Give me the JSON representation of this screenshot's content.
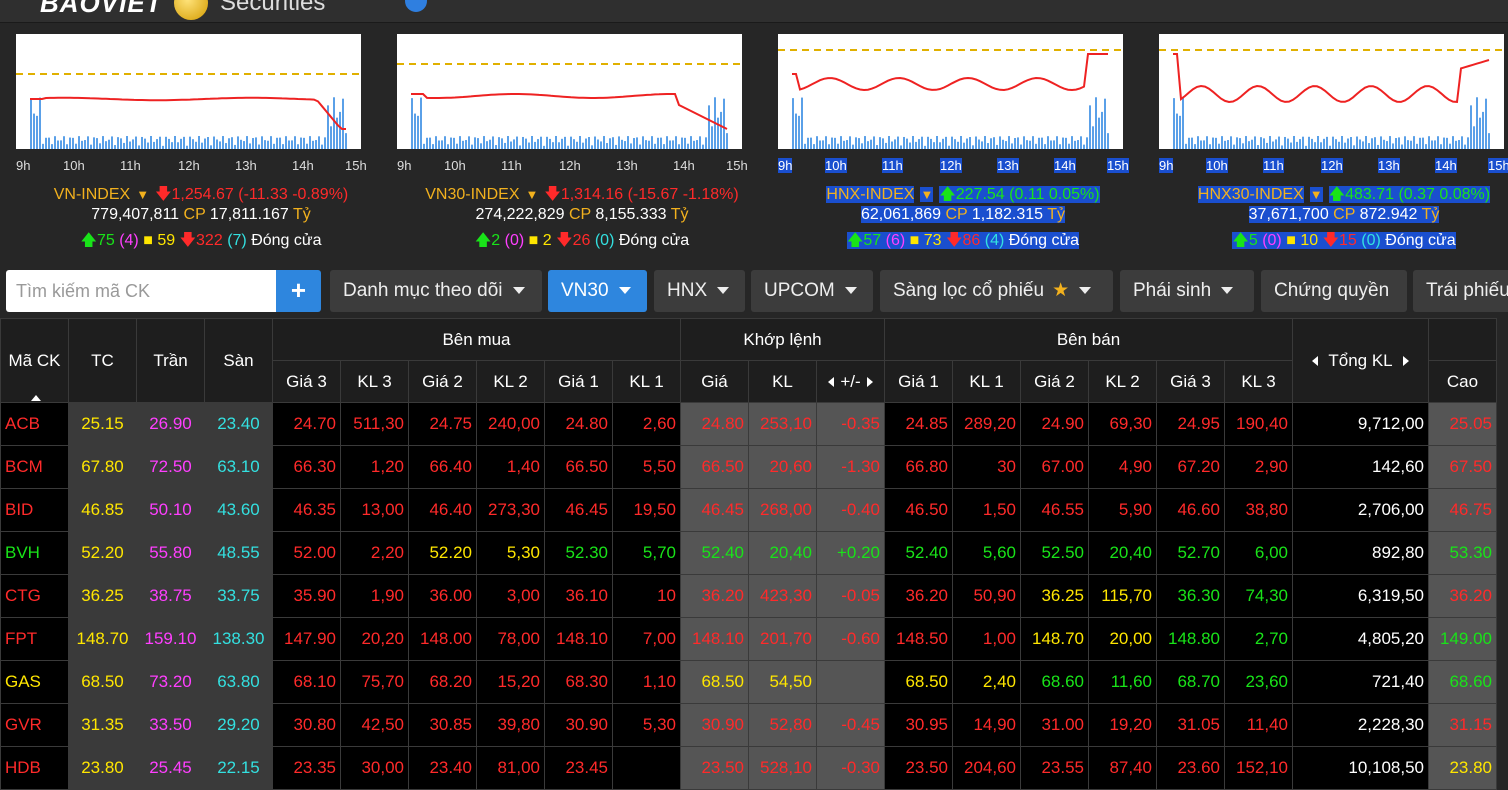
{
  "header": {
    "logo_text": "BAOVIET",
    "logo_sub": "Securities"
  },
  "indices": [
    {
      "name": "VN-INDEX",
      "value": "1,254.67",
      "change": "(-11.33 -0.89%)",
      "direction": "down",
      "volume": "779,407,811",
      "value_traded": "17,811.167",
      "cp_label": "CP",
      "unit": "Tỷ",
      "up": "75",
      "up_ceil": "(4)",
      "ref": "59",
      "down": "322",
      "down_floor": "(7)",
      "status": "Đóng cửa",
      "highlight": false,
      "times": [
        "9h",
        "10h",
        "11h",
        "12h",
        "13h",
        "14h",
        "15h"
      ]
    },
    {
      "name": "VN30-INDEX",
      "value": "1,314.16",
      "change": "(-15.67 -1.18%)",
      "direction": "down",
      "volume": "274,222,829",
      "value_traded": "8,155.333",
      "cp_label": "CP",
      "unit": "Tỷ",
      "up": "2",
      "up_ceil": "(0)",
      "ref": "2",
      "down": "26",
      "down_floor": "(0)",
      "status": "Đóng cửa",
      "highlight": false,
      "times": [
        "9h",
        "10h",
        "11h",
        "12h",
        "13h",
        "14h",
        "15h"
      ]
    },
    {
      "name": "HNX-INDEX",
      "value": "227.54",
      "change": "(0.11 0.05%)",
      "direction": "up",
      "volume": "62,061,869",
      "value_traded": "1,182.315",
      "cp_label": "CP",
      "unit": "Tỷ",
      "up": "57",
      "up_ceil": "(6)",
      "ref": "73",
      "down": "86",
      "down_floor": "(4)",
      "status": "Đóng cửa",
      "highlight": true,
      "times": [
        "9h",
        "10h",
        "11h",
        "12h",
        "13h",
        "14h",
        "15h"
      ]
    },
    {
      "name": "HNX30-INDEX",
      "value": "483.71",
      "change": "(0.37 0.08%)",
      "direction": "up",
      "volume": "37,671,700",
      "value_traded": "872.942",
      "cp_label": "CP",
      "unit": "Tỷ",
      "up": "5",
      "up_ceil": "(0)",
      "ref": "10",
      "down": "15",
      "down_floor": "(0)",
      "status": "Đóng cửa",
      "highlight": true,
      "times": [
        "9h",
        "10h",
        "11h",
        "12h",
        "13h",
        "14h",
        "15h"
      ]
    }
  ],
  "toolbar": {
    "search_placeholder": "Tìm kiếm mã CK",
    "add_label": "+",
    "tabs": [
      "Danh mục theo dõi",
      "VN30",
      "HNX",
      "UPCOM",
      "Sàng lọc cổ phiếu",
      "Phái sinh",
      "Chứng quyền",
      "Trái phiếu"
    ]
  },
  "table": {
    "groups": {
      "sym": "Mã CK",
      "ref": "TC",
      "ceil": "Trần",
      "floor": "Sàn",
      "buy": "Bên mua",
      "match": "Khớp lệnh",
      "sell": "Bên bán",
      "total": "Tổng KL",
      "high": "Cao"
    },
    "buy_cols": [
      "Giá 3",
      "KL 3",
      "Giá 2",
      "KL 2",
      "Giá 1",
      "KL 1"
    ],
    "match_cols": [
      "Giá",
      "KL",
      "+/-"
    ],
    "sell_cols": [
      "Giá 1",
      "KL 1",
      "Giá 2",
      "KL 2",
      "Giá 3",
      "KL 3"
    ],
    "rows": [
      {
        "sym": "ACB",
        "tc": "25.15",
        "tran": "26.90",
        "san": "23.40",
        "b3": "24.70",
        "bk3": "511,30",
        "b2": "24.75",
        "bk2": "240,00",
        "b1": "24.80",
        "bk1": "2,60",
        "mp": "24.80",
        "mk": "253,10",
        "ch": "-0.35",
        "s1": "24.85",
        "sk1": "289,20",
        "s2": "24.90",
        "sk2": "69,30",
        "s3": "24.95",
        "sk3": "190,40",
        "tot": "9,712,00",
        "cao": "25.05"
      },
      {
        "sym": "BCM",
        "tc": "67.80",
        "tran": "72.50",
        "san": "63.10",
        "b3": "66.30",
        "bk3": "1,20",
        "b2": "66.40",
        "bk2": "1,40",
        "b1": "66.50",
        "bk1": "5,50",
        "mp": "66.50",
        "mk": "20,60",
        "ch": "-1.30",
        "s1": "66.80",
        "sk1": "30",
        "s2": "67.00",
        "sk2": "4,90",
        "s3": "67.20",
        "sk3": "2,90",
        "tot": "142,60",
        "cao": "67.50"
      },
      {
        "sym": "BID",
        "tc": "46.85",
        "tran": "50.10",
        "san": "43.60",
        "b3": "46.35",
        "bk3": "13,00",
        "b2": "46.40",
        "bk2": "273,30",
        "b1": "46.45",
        "bk1": "19,50",
        "mp": "46.45",
        "mk": "268,00",
        "ch": "-0.40",
        "s1": "46.50",
        "sk1": "1,50",
        "s2": "46.55",
        "sk2": "5,90",
        "s3": "46.60",
        "sk3": "38,80",
        "tot": "2,706,00",
        "cao": "46.75"
      },
      {
        "sym": "BVH",
        "tc": "52.20",
        "tran": "55.80",
        "san": "48.55",
        "b3": "52.00",
        "bk3": "2,20",
        "b2": "52.20",
        "bk2": "5,30",
        "b1": "52.30",
        "bk1": "5,70",
        "mp": "52.40",
        "mk": "20,40",
        "ch": "+0.20",
        "s1": "52.40",
        "sk1": "5,60",
        "s2": "52.50",
        "sk2": "20,40",
        "s3": "52.70",
        "sk3": "6,00",
        "tot": "892,80",
        "cao": "53.30"
      },
      {
        "sym": "CTG",
        "tc": "36.25",
        "tran": "38.75",
        "san": "33.75",
        "b3": "35.90",
        "bk3": "1,90",
        "b2": "36.00",
        "bk2": "3,00",
        "b1": "36.10",
        "bk1": "10",
        "mp": "36.20",
        "mk": "423,30",
        "ch": "-0.05",
        "s1": "36.20",
        "sk1": "50,90",
        "s2": "36.25",
        "sk2": "115,70",
        "s3": "36.30",
        "sk3": "74,30",
        "tot": "6,319,50",
        "cao": "36.20"
      },
      {
        "sym": "FPT",
        "tc": "148.70",
        "tran": "159.10",
        "san": "138.30",
        "b3": "147.90",
        "bk3": "20,20",
        "b2": "148.00",
        "bk2": "78,00",
        "b1": "148.10",
        "bk1": "7,00",
        "mp": "148.10",
        "mk": "201,70",
        "ch": "-0.60",
        "s1": "148.50",
        "sk1": "1,00",
        "s2": "148.70",
        "sk2": "20,00",
        "s3": "148.80",
        "sk3": "2,70",
        "tot": "4,805,20",
        "cao": "149.00"
      },
      {
        "sym": "GAS",
        "tc": "68.50",
        "tran": "73.20",
        "san": "63.80",
        "b3": "68.10",
        "bk3": "75,70",
        "b2": "68.20",
        "bk2": "15,20",
        "b1": "68.30",
        "bk1": "1,10",
        "mp": "68.50",
        "mk": "54,50",
        "ch": "",
        "s1": "68.50",
        "sk1": "2,40",
        "s2": "68.60",
        "sk2": "11,60",
        "s3": "68.70",
        "sk3": "23,60",
        "tot": "721,40",
        "cao": "68.60"
      },
      {
        "sym": "GVR",
        "tc": "31.35",
        "tran": "33.50",
        "san": "29.20",
        "b3": "30.80",
        "bk3": "42,50",
        "b2": "30.85",
        "bk2": "39,80",
        "b1": "30.90",
        "bk1": "5,30",
        "mp": "30.90",
        "mk": "52,80",
        "ch": "-0.45",
        "s1": "30.95",
        "sk1": "14,90",
        "s2": "31.00",
        "sk2": "19,20",
        "s3": "31.05",
        "sk3": "11,40",
        "tot": "2,228,30",
        "cao": "31.15"
      },
      {
        "sym": "HDB",
        "tc": "23.80",
        "tran": "25.45",
        "san": "22.15",
        "b3": "23.35",
        "bk3": "30,00",
        "b2": "23.40",
        "bk2": "81,00",
        "b1": "23.45",
        "bk1": "",
        "mp": "23.50",
        "mk": "528,10",
        "ch": "-0.30",
        "s1": "23.50",
        "sk1": "204,60",
        "s2": "23.55",
        "sk2": "87,40",
        "s3": "23.60",
        "sk3": "152,10",
        "tot": "10,108,50",
        "cao": "23.80"
      }
    ]
  }
}
